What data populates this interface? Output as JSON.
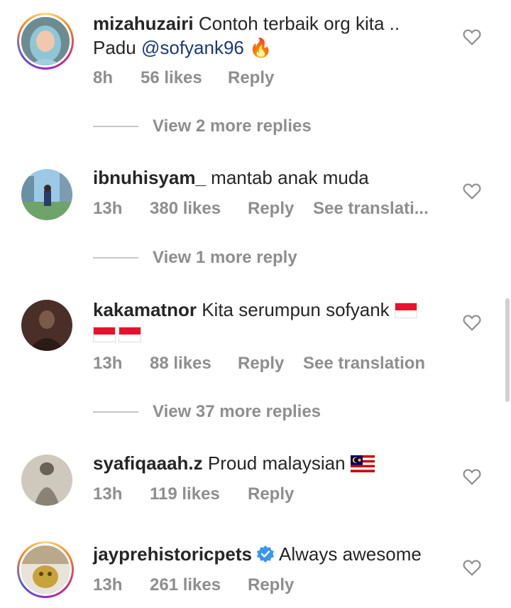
{
  "comments": [
    {
      "username": "mizahuzairi",
      "text_before": "Contoh terbaik org kita .. Padu",
      "mention": "@sofyank96",
      "emoji": "🔥",
      "time": "8h",
      "likes": "56 likes",
      "reply": "Reply",
      "see_translation": "",
      "view_replies": "View 2 more replies"
    },
    {
      "username": "ibnuhisyam_",
      "text": "mantab anak muda",
      "time": "13h",
      "likes": "380 likes",
      "reply": "Reply",
      "see_translation": "See translati...",
      "view_replies": "View 1 more reply"
    },
    {
      "username": "kakamatnor",
      "text": "Kita serumpun sofyank",
      "time": "13h",
      "likes": "88 likes",
      "reply": "Reply",
      "see_translation": "See translation",
      "view_replies": "View 37 more replies"
    },
    {
      "username": "syafiqaaah.z",
      "text": "Proud malaysian",
      "time": "13h",
      "likes": "119 likes",
      "reply": "Reply"
    },
    {
      "username": "jayprehistoricpets",
      "text": "Always awesome",
      "time": "13h",
      "likes": "261 likes",
      "reply": "Reply"
    }
  ],
  "icons": {
    "heart": "heart-outline-icon",
    "verified": "verified-badge-icon",
    "fire": "fire-emoji",
    "flag_indonesia": "indonesia-flag",
    "flag_malaysia": "malaysia-flag"
  },
  "colors": {
    "mention": "#1a3a7a",
    "meta_gray": "#8e8e8e",
    "verified_blue": "#3897f0"
  }
}
